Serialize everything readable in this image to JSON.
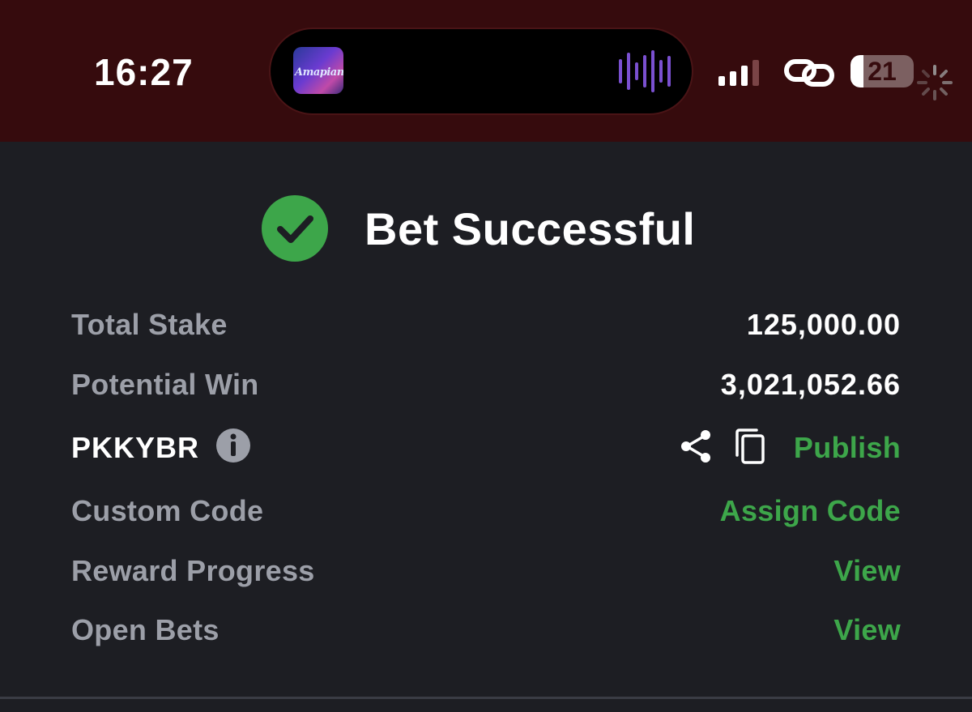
{
  "status_bar": {
    "time": "16:27",
    "battery_level": "21",
    "battery_fraction": 0.21,
    "now_playing": {
      "art_text": "Amapiano",
      "icon": "album-art",
      "waveform_icon": "audio-waveform-icon"
    },
    "signal_bars_active": 3,
    "signal_bars_total": 4,
    "icons": [
      "cellular-signal-icon",
      "link-icon",
      "battery-icon",
      "loading-spinner-icon"
    ],
    "colors": {
      "background": "#360b0d",
      "waveform": "#7a50d0"
    }
  },
  "header": {
    "icon": "check-circle-icon",
    "title": "Bet Successful"
  },
  "details": {
    "total_stake": {
      "label": "Total Stake",
      "value": "125,000.00"
    },
    "potential_win": {
      "label": "Potential Win",
      "value": "3,021,052.66"
    },
    "booking_code": {
      "code": "PKKYBR",
      "info_icon": "info-icon",
      "share_icon": "share-icon",
      "copy_icon": "copy-icon",
      "action": "Publish"
    },
    "custom_code": {
      "label": "Custom Code",
      "action": "Assign Code"
    },
    "reward_progress": {
      "label": "Reward Progress",
      "action": "View"
    },
    "open_bets": {
      "label": "Open Bets",
      "action": "View"
    }
  },
  "colors": {
    "background": "#1d1e23",
    "accent_green": "#3da64a",
    "label_grey": "#9c9fa8",
    "value_white": "#ffffff"
  }
}
